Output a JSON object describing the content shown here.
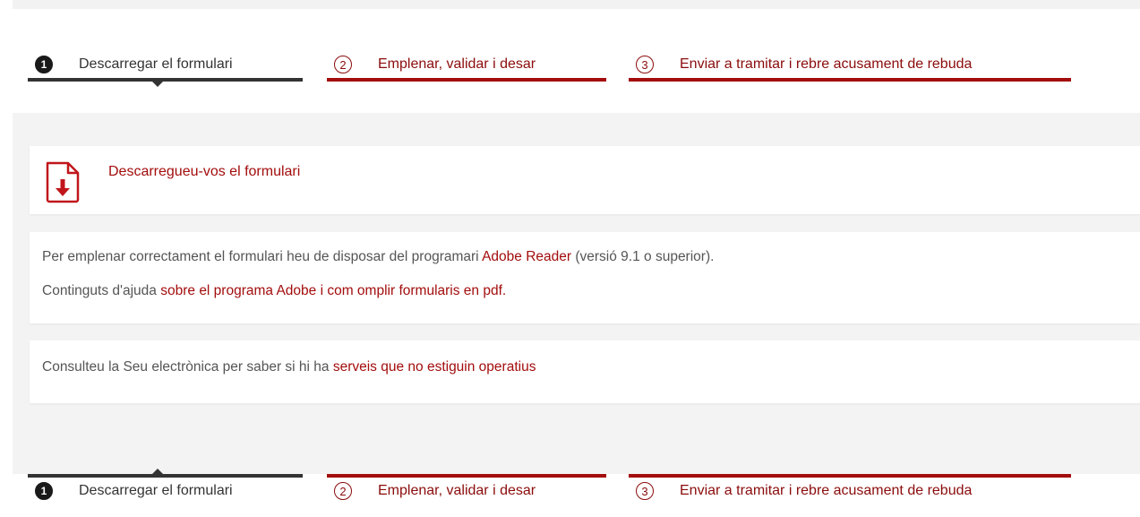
{
  "steps": [
    {
      "number": "1",
      "label": "Descarregar el formulari",
      "state": "active"
    },
    {
      "number": "2",
      "label": "Emplenar, validar i desar",
      "state": "inactive"
    },
    {
      "number": "3",
      "label": "Enviar a tramitar i rebre acusament de rebuda",
      "state": "inactive"
    }
  ],
  "download": {
    "icon": "pdf-download-icon",
    "link_text": "Descarregueu-vos el formulari"
  },
  "info": {
    "line1_before": "Per emplenar correctament el formulari heu de disposar del programari ",
    "line1_link": "Adobe Reader",
    "line1_after": " (versió 9.1 o superior).",
    "line2_before": "Continguts d'ajuda ",
    "line2_link": "sobre el programa Adobe i com omplir formularis en pdf."
  },
  "notice": {
    "before": "Consulteu la Seu electrònica per saber si hi ha ",
    "link": "serveis que no estiguin operatius"
  },
  "colors": {
    "accent": "#a30d0d",
    "active_step": "#333333",
    "panel_background": "#f3f3f3"
  }
}
